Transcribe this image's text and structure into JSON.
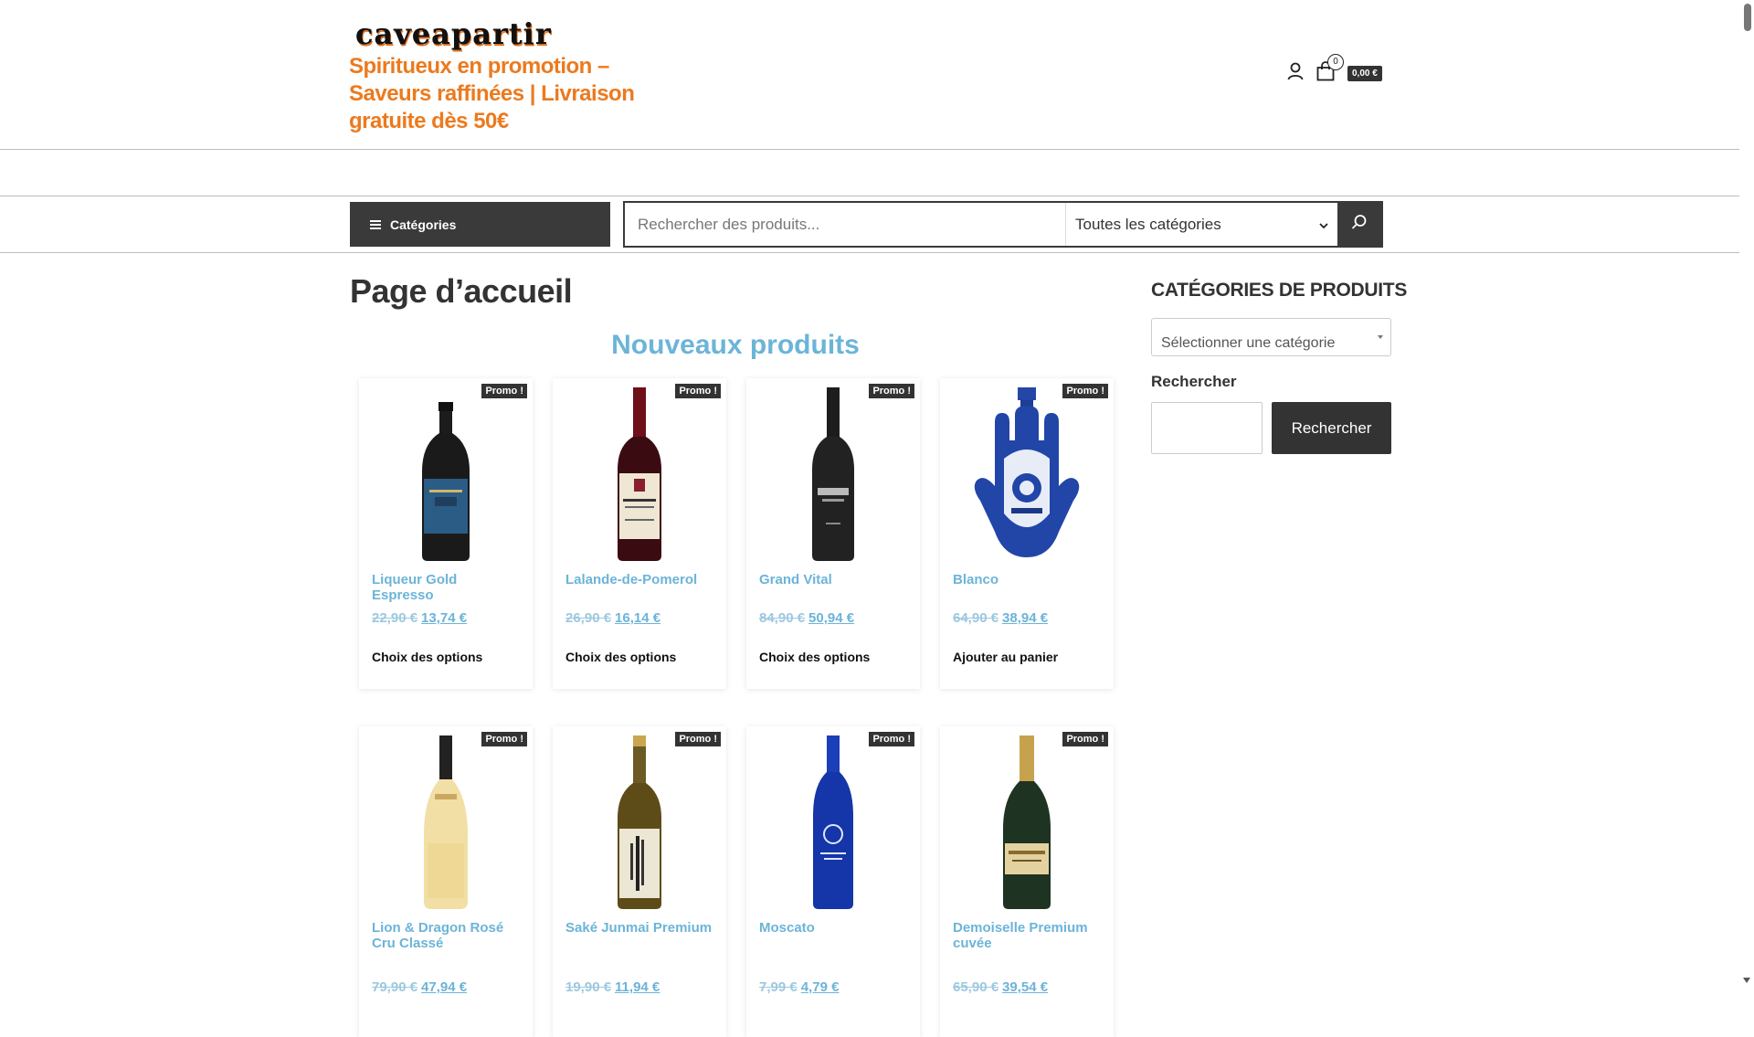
{
  "header": {
    "logo_text": "caveapartir",
    "tagline": "Spiritueux en promotion – Saveurs raffinées | Livraison gratuite dès 50€",
    "cart_count": "0",
    "cart_total": "0,00 €"
  },
  "nav": {
    "categories_label": "Catégories",
    "search_placeholder": "Rechercher des produits...",
    "category_select": "Toutes les catégories"
  },
  "main": {
    "page_title": "Page d’accueil",
    "section_title": "Nouveaux produits",
    "products": [
      {
        "badge": "Promo !",
        "name": "Liqueur Gold Espresso",
        "old_price": "22,90 €",
        "new_price": "13,74 €",
        "action": "Choix des options",
        "bottle": "dark-blue"
      },
      {
        "badge": "Promo !",
        "name": "Lalande-de-Pomerol",
        "old_price": "26,90 €",
        "new_price": "16,14 €",
        "action": "Choix des options",
        "bottle": "bordeaux"
      },
      {
        "badge": "Promo !",
        "name": "Grand Vital",
        "old_price": "84,90 €",
        "new_price": "50,94 €",
        "action": "Choix des options",
        "bottle": "black"
      },
      {
        "badge": "Promo !",
        "name": "Blanco",
        "old_price": "64,90 €",
        "new_price": "38,94 €",
        "action": "Ajouter au panier",
        "bottle": "hamsa"
      },
      {
        "badge": "Promo !",
        "name": "Lion & Dragon Rosé Cru Classé",
        "old_price": "79,90 €",
        "new_price": "47,94 €",
        "action": "",
        "bottle": "rose"
      },
      {
        "badge": "Promo !",
        "name": "Saké Junmai Premium",
        "old_price": "19,90 €",
        "new_price": "11,94 €",
        "action": "",
        "bottle": "sake"
      },
      {
        "badge": "Promo !",
        "name": "Moscato",
        "old_price": "7,99 €",
        "new_price": "4,79 €",
        "action": "",
        "bottle": "blue"
      },
      {
        "badge": "Promo !",
        "name": "Demoiselle Premium cuvée",
        "old_price": "65,90 €",
        "new_price": "39,54 €",
        "action": "",
        "bottle": "champagne"
      }
    ]
  },
  "sidebar": {
    "categories_title": "CATÉGORIES DE PRODUITS",
    "category_placeholder": "Sélectionner une catégorie",
    "search_label": "Rechercher",
    "search_button": "Rechercher"
  }
}
